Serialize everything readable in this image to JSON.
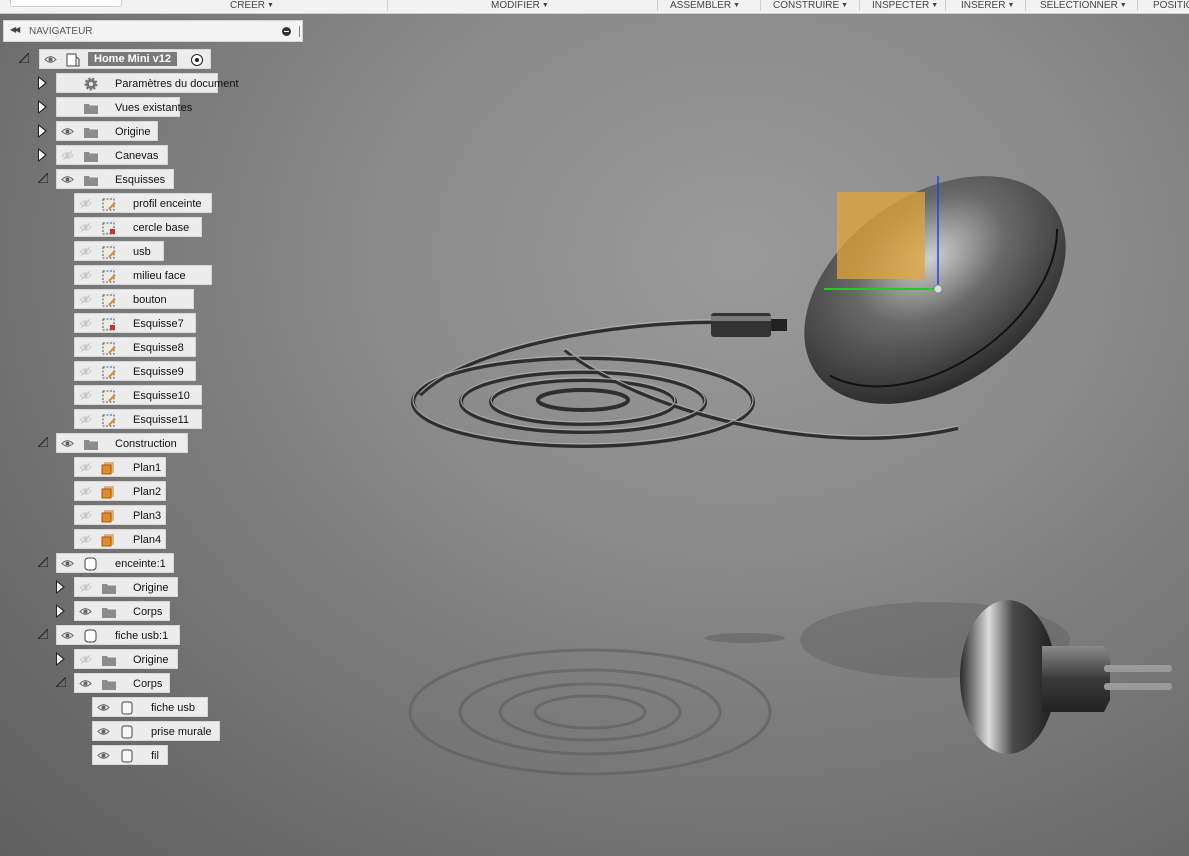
{
  "toolbar": {
    "menus": [
      {
        "label": "CREER"
      },
      {
        "label": "MODIFIER"
      },
      {
        "label": "ASSEMBLER"
      },
      {
        "label": "CONSTRUIRE"
      },
      {
        "label": "INSPECTER"
      },
      {
        "label": "INSERER"
      },
      {
        "label": "SELECTIONNER"
      },
      {
        "label": "POSITIO"
      }
    ]
  },
  "navigator": {
    "title": "NAVIGATEUR",
    "root": {
      "label": "Home Mini v12"
    },
    "items": [
      {
        "label": "Paramètres du document",
        "icon": "gear-icon"
      },
      {
        "label": "Vues existantes",
        "icon": "folder-icon"
      },
      {
        "label": "Origine",
        "icon": "folder-icon"
      },
      {
        "label": "Canevas",
        "icon": "folder-icon"
      },
      {
        "label": "Esquisses",
        "icon": "folder-icon"
      },
      {
        "label": "profil enceinte",
        "icon": "sketch-icon"
      },
      {
        "label": "cercle base",
        "icon": "sketch-locked-icon"
      },
      {
        "label": "usb",
        "icon": "sketch-icon"
      },
      {
        "label": "milieu face",
        "icon": "sketch-icon"
      },
      {
        "label": "bouton",
        "icon": "sketch-icon"
      },
      {
        "label": "Esquisse7",
        "icon": "sketch-locked-icon"
      },
      {
        "label": "Esquisse8",
        "icon": "sketch-icon"
      },
      {
        "label": "Esquisse9",
        "icon": "sketch-icon"
      },
      {
        "label": "Esquisse10",
        "icon": "sketch-icon"
      },
      {
        "label": "Esquisse11",
        "icon": "sketch-icon"
      },
      {
        "label": "Construction",
        "icon": "folder-icon"
      },
      {
        "label": "Plan1",
        "icon": "plane-icon"
      },
      {
        "label": "Plan2",
        "icon": "plane-icon"
      },
      {
        "label": "Plan3",
        "icon": "plane-icon"
      },
      {
        "label": "Plan4",
        "icon": "plane-icon"
      },
      {
        "label": "enceinte:1",
        "icon": "component-icon"
      },
      {
        "label": "Origine",
        "icon": "folder-icon"
      },
      {
        "label": "Corps",
        "icon": "folder-icon"
      },
      {
        "label": "fiche usb:1",
        "icon": "component-icon"
      },
      {
        "label": "Origine",
        "icon": "folder-icon"
      },
      {
        "label": "Corps",
        "icon": "folder-icon"
      },
      {
        "label": "fiche usb",
        "icon": "body-icon"
      },
      {
        "label": "prise murale",
        "icon": "body-icon"
      },
      {
        "label": "fil",
        "icon": "body-icon"
      }
    ]
  },
  "colors": {
    "viewport_bg": "#8a8a8a",
    "plane_fill": "#e0a63a",
    "sketch_icon": "#e08a2a"
  }
}
